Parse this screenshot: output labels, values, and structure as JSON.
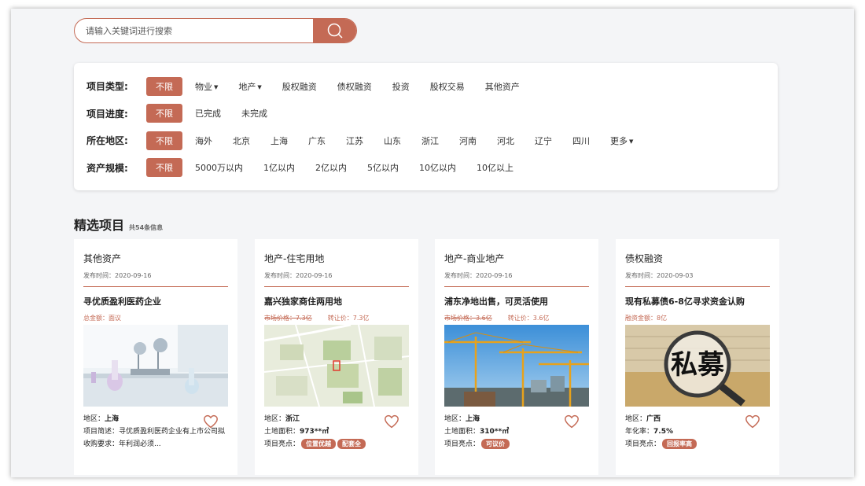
{
  "search": {
    "placeholder": "请输入关键词进行搜索"
  },
  "filters": [
    {
      "label": "项目类型:",
      "options": [
        {
          "text": "不限",
          "active": true
        },
        {
          "text": "物业",
          "caret": true
        },
        {
          "text": "地产",
          "caret": true
        },
        {
          "text": "股权融资"
        },
        {
          "text": "债权融资"
        },
        {
          "text": "投资"
        },
        {
          "text": "股权交易"
        },
        {
          "text": "其他资产"
        }
      ]
    },
    {
      "label": "项目进度:",
      "options": [
        {
          "text": "不限",
          "active": true
        },
        {
          "text": "已完成"
        },
        {
          "text": "未完成"
        }
      ]
    },
    {
      "label": "所在地区:",
      "options": [
        {
          "text": "不限",
          "active": true
        },
        {
          "text": "海外"
        },
        {
          "text": "北京"
        },
        {
          "text": "上海"
        },
        {
          "text": "广东"
        },
        {
          "text": "江苏"
        },
        {
          "text": "山东"
        },
        {
          "text": "浙江"
        },
        {
          "text": "河南"
        },
        {
          "text": "河北"
        },
        {
          "text": "辽宁"
        },
        {
          "text": "四川"
        },
        {
          "text": "更多",
          "caret": true
        }
      ]
    },
    {
      "label": "资产规模:",
      "options": [
        {
          "text": "不限",
          "active": true
        },
        {
          "text": "5000万以内"
        },
        {
          "text": "1亿以内"
        },
        {
          "text": "2亿以内"
        },
        {
          "text": "5亿以内"
        },
        {
          "text": "10亿以内"
        },
        {
          "text": "10亿以上"
        }
      ]
    }
  ],
  "section": {
    "title": "精选项目",
    "count": "共54条信息"
  },
  "cards": [
    {
      "category": "其他资产",
      "date": "发布时间：2020-09-16",
      "title": "寻优质盈利医药企业",
      "price_label": "总金额：面议",
      "region_label": "地区：",
      "region": "上海",
      "desc": "项目简述：寻优质盈利医药企业有上市公司拟收购要求：年利润必须..."
    },
    {
      "category": "地产-住宅用地",
      "date": "发布时间：2020-09-16",
      "title": "嘉兴独家商住两用地",
      "market_price": "市场价格：7.3亿",
      "transfer_price": "转让价：7.3亿",
      "region_label": "地区：",
      "region": "浙江",
      "area_label": "土地面积：",
      "area": "973**㎡",
      "highlight_label": "项目亮点：",
      "tags": [
        "位置优越",
        "配套全"
      ]
    },
    {
      "category": "地产-商业地产",
      "date": "发布时间：2020-09-16",
      "title": "浦东净地出售，可灵活使用",
      "market_price": "市场价格：3.6亿",
      "transfer_price": "转让价：3.6亿",
      "region_label": "地区：",
      "region": "上海",
      "area_label": "土地面积：",
      "area": "310**㎡",
      "highlight_label": "项目亮点：",
      "tags": [
        "可议价"
      ]
    },
    {
      "category": "债权融资",
      "date": "发布时间：2020-09-03",
      "title": "现有私募债6-8亿寻求资金认购",
      "price_label": "融资金额：8亿",
      "image_text": "私募",
      "region_label": "地区：",
      "region": "广西",
      "rate_label": "年化率：",
      "rate": "7.5%",
      "highlight_label": "项目亮点：",
      "tags": [
        "回报率高"
      ]
    }
  ],
  "colors": {
    "accent": "#c46a55",
    "background": "#f4f5f7"
  }
}
